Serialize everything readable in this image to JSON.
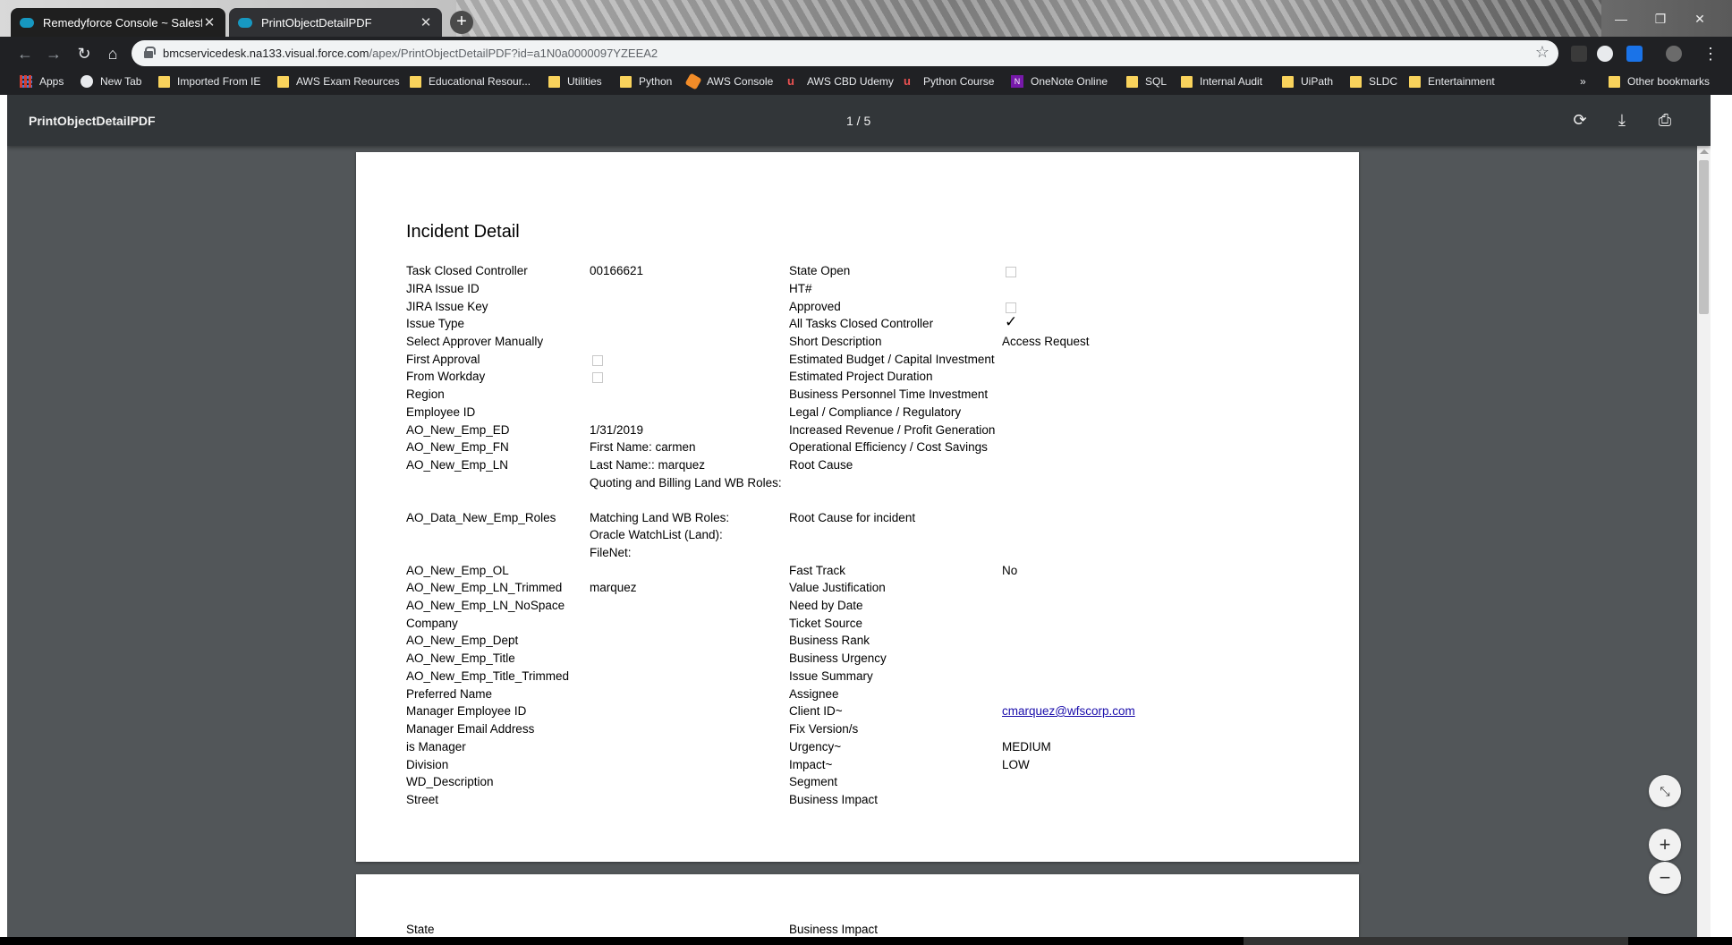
{
  "browser": {
    "tabs": [
      {
        "title": "Remedyforce Console ~ Salesforce"
      },
      {
        "title": "PrintObjectDetailPDF"
      }
    ],
    "url_host": "bmcservicedesk.na133.visual.force.com",
    "url_path": "/apex/PrintObjectDetailPDF?id=a1N0a0000097YZEEA2",
    "bookmarks": [
      {
        "label": "Apps",
        "icon": "apps-grid-icon"
      },
      {
        "label": "New Tab",
        "icon": "globe-icon"
      },
      {
        "label": "Imported From IE",
        "icon": "folder-icon"
      },
      {
        "label": "AWS Exam Reources",
        "icon": "folder-icon"
      },
      {
        "label": "Educational Resour...",
        "icon": "folder-icon"
      },
      {
        "label": "Utilities",
        "icon": "folder-icon"
      },
      {
        "label": "Python",
        "icon": "folder-icon"
      },
      {
        "label": "AWS Console",
        "icon": "aws-icon"
      },
      {
        "label": "AWS CBD Udemy",
        "icon": "udemy-icon"
      },
      {
        "label": "Python Course",
        "icon": "udemy-icon"
      },
      {
        "label": "OneNote Online",
        "icon": "onenote-icon"
      },
      {
        "label": "SQL",
        "icon": "folder-icon"
      },
      {
        "label": "Internal Audit",
        "icon": "folder-icon"
      },
      {
        "label": "UiPath",
        "icon": "folder-icon"
      },
      {
        "label": "SLDC",
        "icon": "folder-icon"
      },
      {
        "label": "Entertainment",
        "icon": "folder-icon"
      }
    ],
    "more_bookmarks": "»",
    "other_bookmarks": "Other bookmarks"
  },
  "pdf": {
    "title": "PrintObjectDetailPDF",
    "page_indicator": "1 / 5",
    "document_title": "Incident Detail",
    "left_labels": [
      "Task Closed Controller",
      "JIRA Issue ID",
      "JIRA Issue Key",
      "Issue Type",
      "Select Approver Manually",
      "First Approval",
      "From Workday",
      "Region",
      "Employee ID",
      "AO_New_Emp_ED",
      "AO_New_Emp_FN",
      "AO_New_Emp_LN",
      "AO_Data_New_Emp_Roles",
      "AO_New_Emp_OL",
      "AO_New_Emp_LN_Trimmed",
      "AO_New_Emp_LN_NoSpace",
      "Company",
      "AO_New_Emp_Dept",
      "AO_New_Emp_Title",
      "AO_New_Emp_Title_Trimmed",
      "Preferred Name",
      "Manager Employee ID",
      "Manager Email Address",
      "is Manager",
      "Division",
      "WD_Description",
      "Street"
    ],
    "left_values": {
      "task_closed_controller": "00166621",
      "emp_ed": "1/31/2019",
      "emp_fn": "First Name: carmen",
      "emp_ln": "Last Name:: marquez",
      "quoting_roles": "Quoting and Billing Land WB Roles:",
      "matching_roles": "Matching Land WB Roles:",
      "oracle_watchlist": "Oracle WatchList (Land):",
      "filenet": "FileNet:",
      "ln_trimmed": "marquez"
    },
    "right_labels": [
      "State Open",
      "HT#",
      "Approved",
      "All Tasks Closed Controller",
      "Short Description",
      "Estimated Budget / Capital Investment",
      "Estimated Project Duration",
      "Business Personnel Time Investment",
      "Legal / Compliance / Regulatory",
      "Increased Revenue / Profit Generation",
      "Operational Efficiency / Cost Savings",
      "Root Cause",
      "Root Cause for incident",
      "Fast Track",
      "Value Justification",
      "Need by Date",
      "Ticket Source",
      "Business Rank",
      "Business Urgency",
      "Issue Summary",
      "Assignee",
      "Client ID~",
      "Fix Version/s",
      "Urgency~",
      "Impact~",
      "Segment",
      "Business Impact"
    ],
    "right_values": {
      "short_description": "Access Request",
      "fast_track": "No",
      "client_id": "cmarquez@wfscorp.com",
      "urgency": "MEDIUM",
      "impact": "LOW",
      "all_tasks_closed_mark": "✓"
    },
    "page2": {
      "left_label": "State",
      "right_label": "Business Impact"
    }
  }
}
